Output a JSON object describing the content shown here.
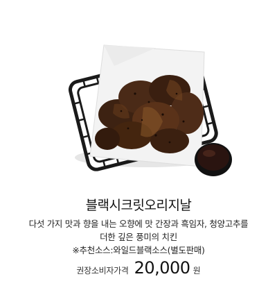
{
  "product": {
    "name": "블랙시크릿오리지날",
    "description_lines": [
      "다섯 가지 맛과 향을 내는 오향에 맛 간장과 흑임자, 청양고추를",
      "더한 깊은 풍미의 치킨",
      "※추천소스:와일드블랙소스(별도판매)"
    ],
    "price_label": "권장소비자가격",
    "price": "20,000",
    "price_unit": "원",
    "image_icon": "fried-chicken-basket-with-sauce-icon"
  },
  "colors": {
    "background": "#ffffff",
    "text": "#111111",
    "chicken": "#4a2a17",
    "sauce": "#2a1410",
    "basket": "#1a1a1a",
    "paper": "#f2f2f2"
  }
}
